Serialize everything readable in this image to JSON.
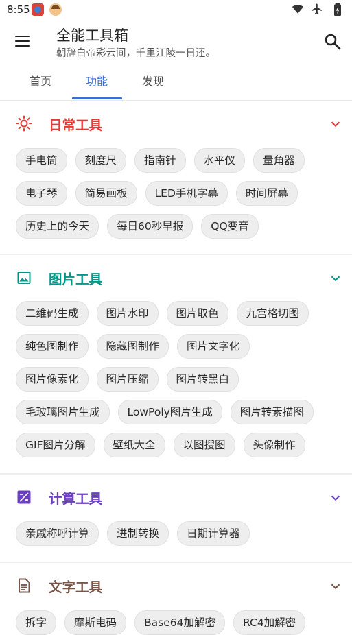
{
  "status_bar": {
    "time": "8:55"
  },
  "toolbar": {
    "title": "全能工具箱",
    "subtitle": "朝辞白帝彩云间，千里江陵一日还。"
  },
  "tabs": [
    {
      "label": "首页"
    },
    {
      "label": "功能"
    },
    {
      "label": "发现"
    }
  ],
  "colors": {
    "accent": "#3a6fd1",
    "daily": "#e53935",
    "image": "#009688",
    "calc": "#6a3fc1",
    "text": "#795548"
  },
  "sections": [
    {
      "title": "日常工具",
      "icon": "sun-icon",
      "rows": [
        [
          "手电筒",
          "刻度尺",
          "指南针",
          "水平仪",
          "量角器"
        ],
        [
          "电子琴",
          "简易画板",
          "LED手机字幕",
          "时间屏幕"
        ],
        [
          "历史上的今天",
          "每日60秒早报",
          "QQ变音"
        ]
      ]
    },
    {
      "title": "图片工具",
      "icon": "image-icon",
      "rows": [
        [
          "二维码生成",
          "图片水印",
          "图片取色",
          "九宫格切图"
        ],
        [
          "纯色图制作",
          "隐藏图制作",
          "图片文字化"
        ],
        [
          "图片像素化",
          "图片压缩",
          "图片转黑白"
        ],
        [
          "毛玻璃图片生成",
          "LowPoly图片生成",
          "图片转素描图"
        ],
        [
          "GIF图片分解",
          "壁纸大全",
          "以图搜图",
          "头像制作"
        ]
      ]
    },
    {
      "title": "计算工具",
      "icon": "calculator-icon",
      "rows": [
        [
          "亲戚称呼计算",
          "进制转换",
          "日期计算器"
        ]
      ]
    },
    {
      "title": "文字工具",
      "icon": "document-icon",
      "rows": [
        [
          "拆字",
          "摩斯电码",
          "Base64加解密",
          "RC4加解密"
        ]
      ]
    }
  ]
}
